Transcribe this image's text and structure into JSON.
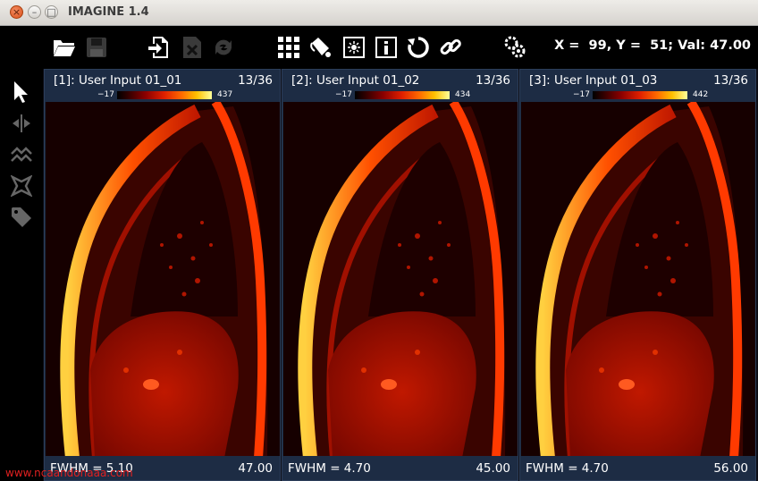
{
  "window": {
    "title": "IMAGINE 1.4",
    "buttons": {
      "close": "×",
      "minimize": "–",
      "maximize": "□"
    }
  },
  "toolbar": {
    "icons": [
      "open-folder-icon",
      "save-icon",
      "import-icon",
      "close-image-icon",
      "sync-icon",
      "grid-layout-icon",
      "color-palette-icon",
      "brightness-icon",
      "info-icon",
      "reset-icon",
      "link-icon",
      "settings-icon"
    ],
    "coords": "X =  99, Y =  51; Val: 47.00"
  },
  "tools": [
    "pointer-icon",
    "flip-icon",
    "profile-icon",
    "star-roi-icon",
    "tag-icon"
  ],
  "panels": [
    {
      "title": "[1]: User Input 01_01",
      "slice": "13/36",
      "cmin": "−17",
      "cmax": "437",
      "fwhm": "FWHM = 5.10",
      "value": "47.00"
    },
    {
      "title": "[2]: User Input 01_02",
      "slice": "13/36",
      "cmin": "−17",
      "cmax": "434",
      "fwhm": "FWHM = 4.70",
      "value": "45.00"
    },
    {
      "title": "[3]: User Input 01_03",
      "slice": "13/36",
      "cmin": "−17",
      "cmax": "442",
      "fwhm": "FWHM = 4.70",
      "value": "56.00"
    }
  ],
  "watermark": "www.ncaandonaaa.com",
  "colors": {
    "toolbar_bg": "#000000",
    "panel_bg": "#1d2c44",
    "accent": "#ff4000"
  }
}
